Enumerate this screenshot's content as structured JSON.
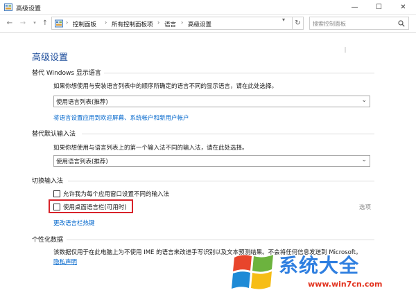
{
  "window": {
    "title": "高级设置",
    "minimize": "—",
    "maximize": "☐",
    "close": "✕"
  },
  "nav": {
    "back": "←",
    "forward": "→",
    "recent": "▾",
    "up": "↑",
    "breadcrumb": [
      "控制面板",
      "所有控制面板项",
      "语言",
      "高级设置"
    ],
    "crumb_separator": "›",
    "refresh": "↻",
    "search_placeholder": "搜索控制面板"
  },
  "page": {
    "title": "高级设置",
    "display_language": {
      "heading": "替代 Windows 显示语言",
      "description": "如果你想使用与安装语言列表中的顺序所确定的语言不同的显示语言，请在此处选择。",
      "select_value": "使用语言列表(推荐)",
      "link": "将语言设置应用到欢迎屏幕、系统帐户和新用户帐户"
    },
    "input_method": {
      "heading": "替代默认输入法",
      "description": "如果你想使用与语言列表上的第一个输入法不同的输入法，请在此处选择。",
      "select_value": "使用语言列表(推荐)"
    },
    "switching": {
      "heading": "切换输入法",
      "checkbox_per_app": "允许我为每个应用窗口设置不同的输入法",
      "checkbox_language_bar": "使用桌面语言栏(可用时)",
      "options_link": "选项",
      "hotkeys_link": "更改语言栏热键"
    },
    "personalization": {
      "heading": "个性化数据",
      "description": "该数据仅用于在此电脑上为不使用 IME 的语言来改进手写识别以及文本预测结果。不会将任何信息发送到 Microsoft。",
      "privacy_link": "隐私声明"
    }
  },
  "watermark": {
    "text": "系统大全",
    "url": "www.win7cn.com"
  },
  "colors": {
    "accent": "#1e4e9c",
    "link": "#0066cc",
    "highlight": "#d8232a"
  }
}
